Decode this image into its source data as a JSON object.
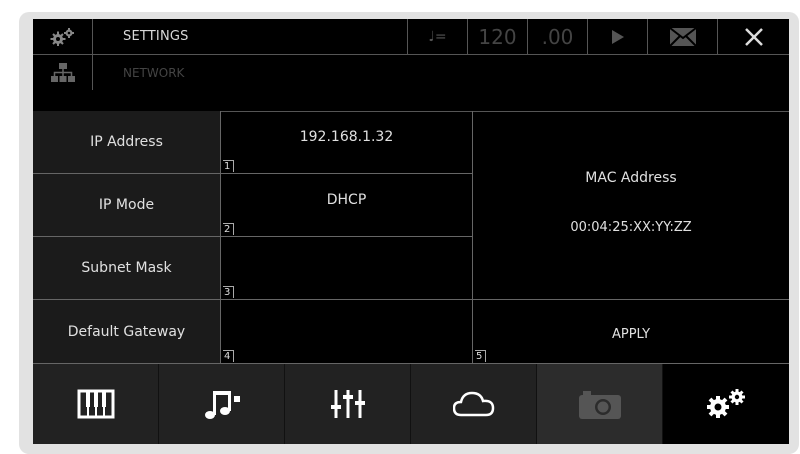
{
  "header": {
    "settings_label": "SETTINGS",
    "tempo_symbol": "♩=",
    "tempo_value": "120",
    "tempo_decimal": ".00",
    "play_icon": "play-icon",
    "mail_icon": "mail-icon",
    "close_icon": "close-icon"
  },
  "subheader": {
    "network_label": "NETWORK"
  },
  "fields": [
    {
      "label": "IP Address",
      "value": "192.168.1.32",
      "index": "1"
    },
    {
      "label": "IP Mode",
      "value": "DHCP",
      "index": "2"
    },
    {
      "label": "Subnet Mask",
      "value": "",
      "index": "3"
    },
    {
      "label": "Default Gateway",
      "value": "",
      "index": "4"
    }
  ],
  "mac": {
    "label": "MAC Address",
    "value": "00:04:25:XX:YY:ZZ"
  },
  "apply": {
    "label": "APPLY",
    "index": "5"
  },
  "dock": [
    {
      "name": "piano-keys-icon",
      "state": "normal"
    },
    {
      "name": "music-notes-icon",
      "state": "normal"
    },
    {
      "name": "mixer-sliders-icon",
      "state": "normal"
    },
    {
      "name": "cloud-icon",
      "state": "normal"
    },
    {
      "name": "camera-icon",
      "state": "disabled"
    },
    {
      "name": "settings-gears-icon",
      "state": "active"
    }
  ],
  "colors": {
    "background": "#000000",
    "panel": "#1b1b1b",
    "dock": "#222222",
    "text": "#d9d9d9"
  }
}
